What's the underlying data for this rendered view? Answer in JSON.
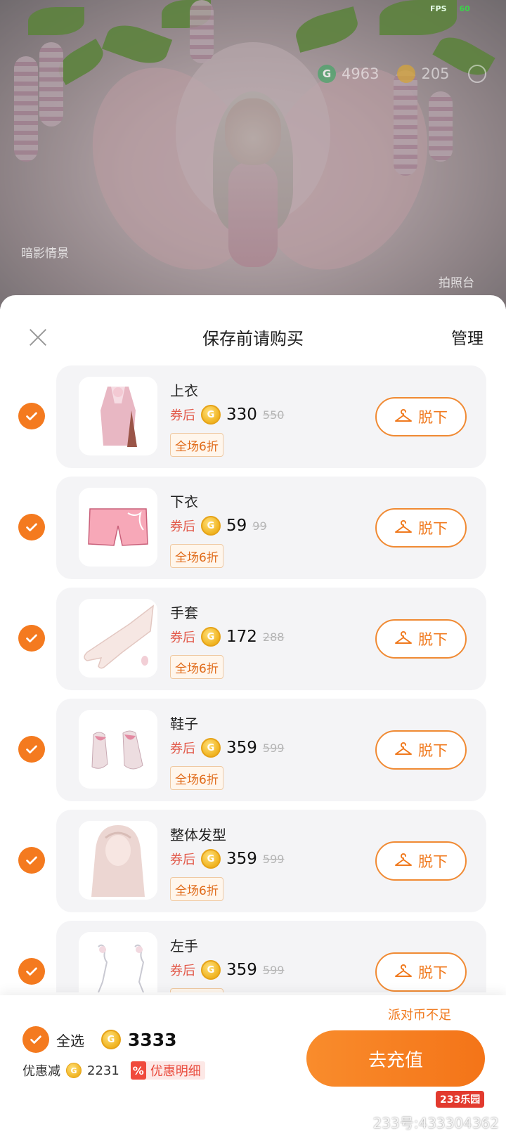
{
  "hud": {
    "fps_label": "FPS",
    "fps_value": "60",
    "coin_g_value": "4963",
    "coin_gold_value": "205",
    "left_label": "暗影情景",
    "right_label": "拍照台"
  },
  "sheet": {
    "title": "保存前请购买",
    "manage_label": "管理",
    "coupon_after_label": "券后",
    "discount_tag": "全场6折",
    "take_off_label": "脱下",
    "items": [
      {
        "name": "上衣",
        "price": "330",
        "original_price": "550",
        "selected": true
      },
      {
        "name": "下衣",
        "price": "59",
        "original_price": "99",
        "selected": true
      },
      {
        "name": "手套",
        "price": "172",
        "original_price": "288",
        "selected": true
      },
      {
        "name": "鞋子",
        "price": "359",
        "original_price": "599",
        "selected": true
      },
      {
        "name": "整体发型",
        "price": "359",
        "original_price": "599",
        "selected": true
      },
      {
        "name": "左手",
        "price": "359",
        "original_price": "599",
        "selected": true
      }
    ]
  },
  "footer": {
    "insufficient_text": "派对币不足",
    "select_all_label": "全选",
    "total_price": "3333",
    "discount_label": "优惠减",
    "discount_amount": "2231",
    "detail_icon_text": "%",
    "detail_label": "优惠明细",
    "recharge_label": "去充值"
  },
  "watermark": {
    "logo": "233乐园",
    "text": "233号:433304362"
  },
  "colors": {
    "accent": "#f47a1f",
    "coupon_red": "#e25a4b",
    "card_bg": "#f4f4f6"
  }
}
